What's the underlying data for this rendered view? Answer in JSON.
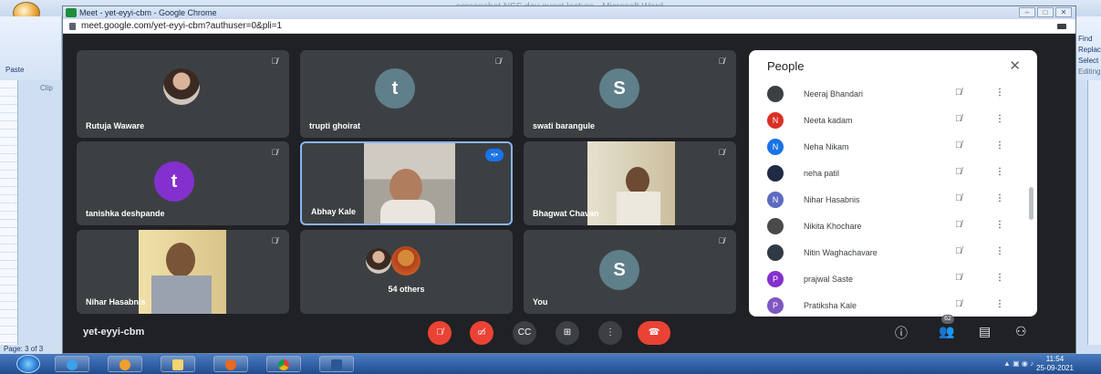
{
  "word": {
    "doc_title": "screenshot NSS day guest lecture - Microsoft Word",
    "paste_label": "Paste",
    "clipboard_label": "Clip",
    "find_label": "Find",
    "replace_label": "Replace",
    "select_label": "Select",
    "editing_label": "Editing",
    "page_status": "Page: 3 of 3"
  },
  "chrome": {
    "window_title": "Meet - yet-eyyi-cbm - Google Chrome",
    "url": "meet.google.com/yet-eyyi-cbm?authuser=0&pli=1"
  },
  "tiles": [
    {
      "name": "Rutuja Waware",
      "type": "photo"
    },
    {
      "name": "trupti ghoirat",
      "type": "letter",
      "letter": "t",
      "color": "#5f7f8a"
    },
    {
      "name": "swati barangule",
      "type": "letter",
      "letter": "S",
      "color": "#5f7f8a"
    },
    {
      "name": "tanishka deshpande",
      "type": "letter",
      "letter": "t",
      "color": "#8430ce"
    },
    {
      "name": "Abhay Kale",
      "type": "video"
    },
    {
      "name": "Bhagwat Chavan",
      "type": "video"
    },
    {
      "name": "Nihar Hasabnis",
      "type": "video"
    },
    {
      "name": "54 others",
      "type": "others"
    },
    {
      "name": "You",
      "type": "letter",
      "letter": "S",
      "color": "#5f7f8a"
    }
  ],
  "meeting_code": "yet-eyyi-cbm",
  "participant_count": "62",
  "people_panel": {
    "title": "People",
    "participants": [
      {
        "name": "Neeraj Bhandari",
        "initial": "",
        "color": "#3c4043"
      },
      {
        "name": "Neeta kadam",
        "initial": "N",
        "color": "#d93025"
      },
      {
        "name": "Neha Nikam",
        "initial": "N",
        "color": "#1a73e8"
      },
      {
        "name": "neha patil",
        "initial": "",
        "color": "#1f2a44"
      },
      {
        "name": "Nihar Hasabnis",
        "initial": "N",
        "color": "#5c6bc0"
      },
      {
        "name": "Nikita Khochare",
        "initial": "",
        "color": "#4a4a4a"
      },
      {
        "name": "Nitin Waghachavare",
        "initial": "",
        "color": "#2f3a44"
      },
      {
        "name": "prajwal Saste",
        "initial": "P",
        "color": "#8430ce"
      },
      {
        "name": "Pratiksha Kale",
        "initial": "P",
        "color": "#7e57c2"
      }
    ]
  },
  "taskbar": {
    "time": "11:54",
    "date": "25-09-2021"
  }
}
